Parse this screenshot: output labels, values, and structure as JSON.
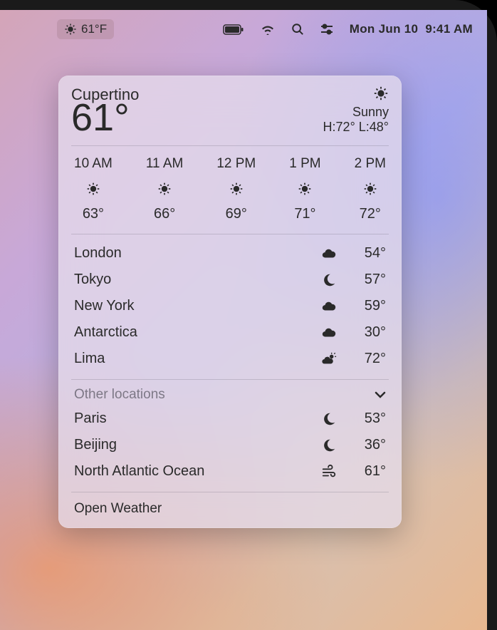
{
  "menubar": {
    "weather_temp": "61°F",
    "date": "Mon Jun 10",
    "time": "9:41 AM"
  },
  "panel": {
    "location": "Cupertino",
    "temp": "61°",
    "condition": "Sunny",
    "hilo": "H:72° L:48°"
  },
  "hourly": [
    {
      "time": "10 AM",
      "temp": "63°",
      "icon": "sun"
    },
    {
      "time": "11 AM",
      "temp": "66°",
      "icon": "sun"
    },
    {
      "time": "12 PM",
      "temp": "69°",
      "icon": "sun"
    },
    {
      "time": "1 PM",
      "temp": "71°",
      "icon": "sun"
    },
    {
      "time": "2 PM",
      "temp": "72°",
      "icon": "sun"
    }
  ],
  "locations": [
    {
      "name": "London",
      "temp": "54°",
      "icon": "cloud"
    },
    {
      "name": "Tokyo",
      "temp": "57°",
      "icon": "moon"
    },
    {
      "name": "New York",
      "temp": "59°",
      "icon": "cloud"
    },
    {
      "name": "Antarctica",
      "temp": "30°",
      "icon": "cloud"
    },
    {
      "name": "Lima",
      "temp": "72°",
      "icon": "partly"
    }
  ],
  "other": {
    "header": "Other locations",
    "items": [
      {
        "name": "Paris",
        "temp": "53°",
        "icon": "moon"
      },
      {
        "name": "Beijing",
        "temp": "36°",
        "icon": "moon"
      },
      {
        "name": "North Atlantic Ocean",
        "temp": "61°",
        "icon": "wind"
      }
    ]
  },
  "footer": {
    "open": "Open Weather"
  }
}
